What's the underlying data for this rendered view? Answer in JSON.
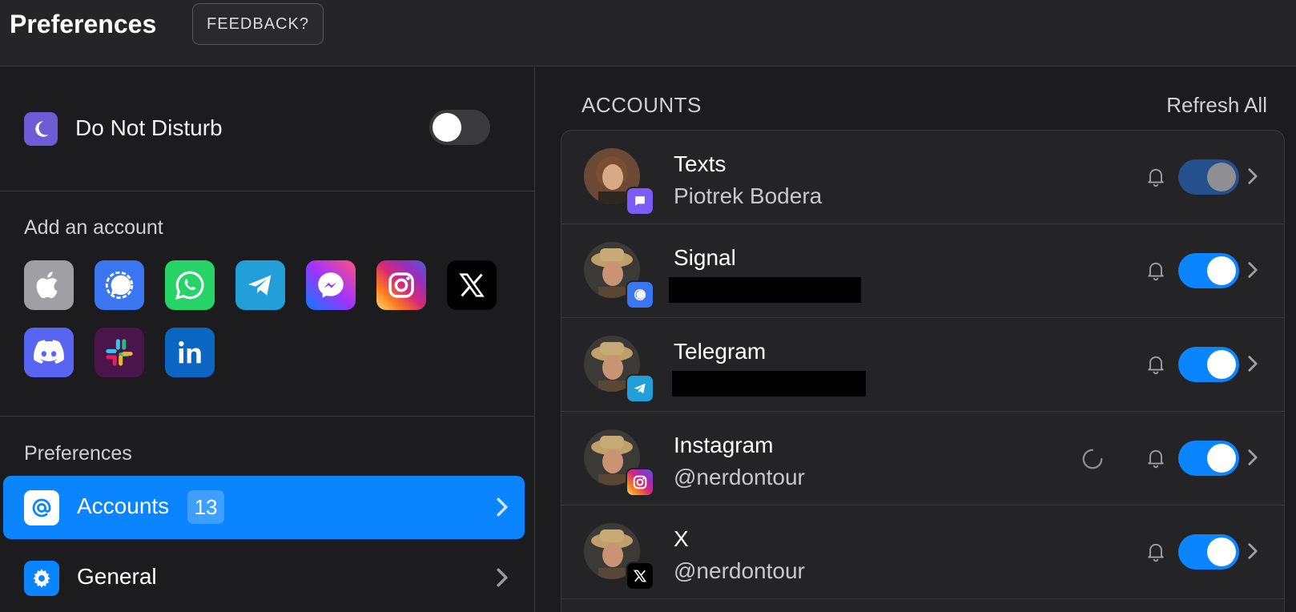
{
  "header": {
    "title": "Preferences",
    "feedback_label": "FEEDBACK?"
  },
  "left": {
    "dnd": {
      "label": "Do Not Disturb",
      "enabled": false
    },
    "add_account": {
      "title": "Add an account",
      "services": [
        "iMessage",
        "Signal",
        "WhatsApp",
        "Telegram",
        "Messenger",
        "Instagram",
        "X",
        "Discord",
        "Slack",
        "LinkedIn"
      ]
    },
    "preferences": {
      "title": "Preferences",
      "items": [
        {
          "label": "Accounts",
          "badge": "13",
          "active": true,
          "icon": "at-sign-icon"
        },
        {
          "label": "General",
          "active": false,
          "icon": "gear-icon"
        }
      ]
    }
  },
  "accounts": {
    "title": "ACCOUNTS",
    "refresh_label": "Refresh All",
    "rows": [
      {
        "network": "Texts",
        "user": "Piotrek Bodera",
        "redacted": false,
        "enabled": true,
        "toggle_state": "disabled",
        "loading": false,
        "badge_color": "#7b5cf6"
      },
      {
        "network": "Signal",
        "user": "",
        "redacted": true,
        "enabled": true,
        "toggle_state": "on",
        "loading": false,
        "badge_color": "#3a76f0"
      },
      {
        "network": "Telegram",
        "user": "",
        "redacted": true,
        "enabled": true,
        "toggle_state": "on",
        "loading": false,
        "badge_color": "#229ed9"
      },
      {
        "network": "Instagram",
        "user": "@nerdontour",
        "redacted": false,
        "enabled": true,
        "toggle_state": "on",
        "loading": true,
        "badge_color": "#e1306c"
      },
      {
        "network": "X",
        "user": "@nerdontour",
        "redacted": false,
        "enabled": true,
        "toggle_state": "on",
        "loading": false,
        "badge_color": "#000000"
      }
    ]
  },
  "colors": {
    "accent": "#0a84ff",
    "background": "#1c1c1e",
    "panel": "#242426",
    "divider": "#3a3a3c"
  }
}
